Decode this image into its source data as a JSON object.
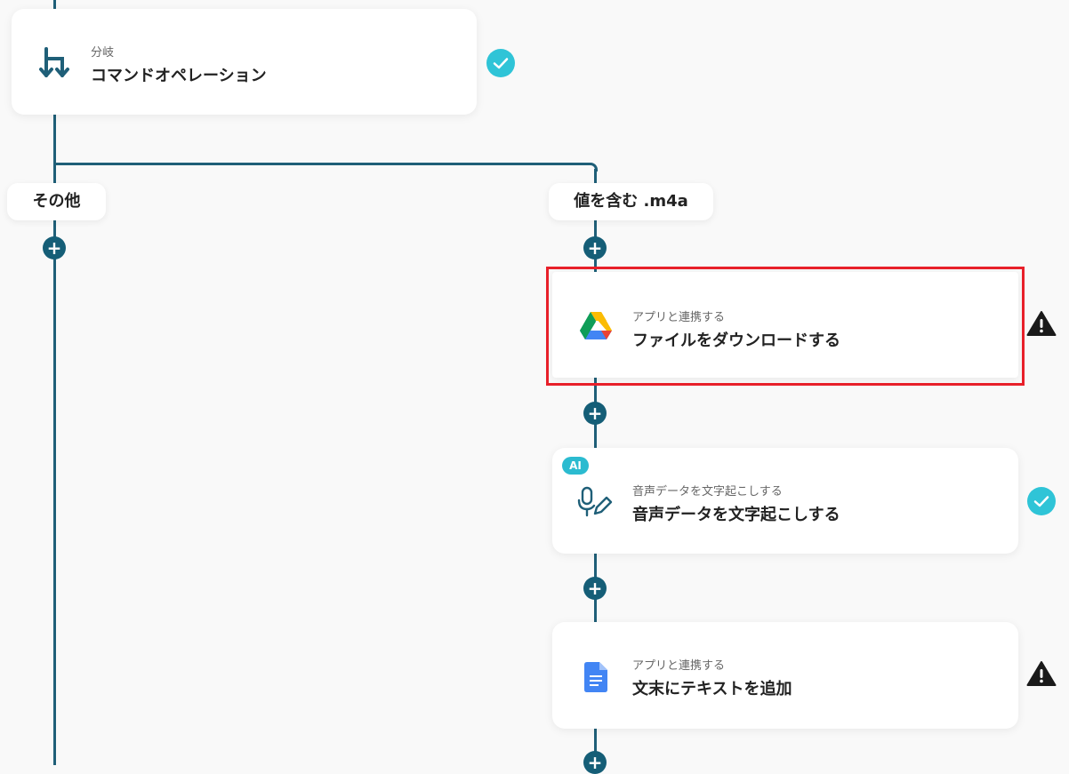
{
  "branch_node": {
    "subtitle": "分岐",
    "title": "コマンドオペレーション"
  },
  "branches": {
    "other_label": "その他",
    "match_label": "値を含む .m4a"
  },
  "steps": [
    {
      "subtitle": "アプリと連携する",
      "title": "ファイルをダウンロードする",
      "icon": "google-drive-icon",
      "status": "warning"
    },
    {
      "subtitle": "音声データを文字起こしする",
      "title": "音声データを文字起こしする",
      "icon": "microphone-pen-icon",
      "badge": "AI",
      "status": "done"
    },
    {
      "subtitle": "アプリと連携する",
      "title": "文末にテキストを追加",
      "icon": "google-docs-icon",
      "status": "warning"
    }
  ],
  "add_symbol": "+",
  "colors": {
    "connector": "#1f5f78",
    "check": "#2fc4d7",
    "highlight": "#e8202a",
    "warning": "#1a1a1a"
  }
}
